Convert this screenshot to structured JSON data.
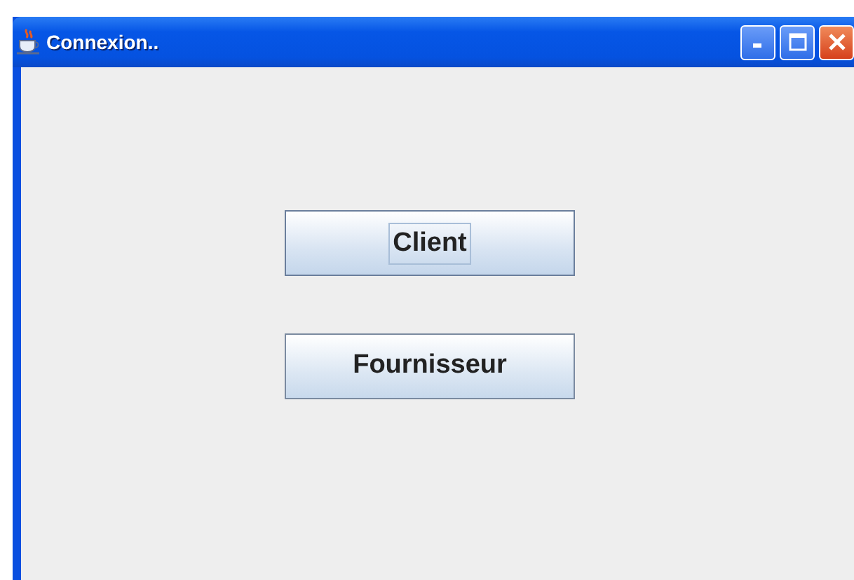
{
  "window": {
    "title": "Connexion.."
  },
  "buttons": [
    {
      "label": "Client",
      "focused": true
    },
    {
      "label": "Fournisseur",
      "focused": false
    }
  ]
}
